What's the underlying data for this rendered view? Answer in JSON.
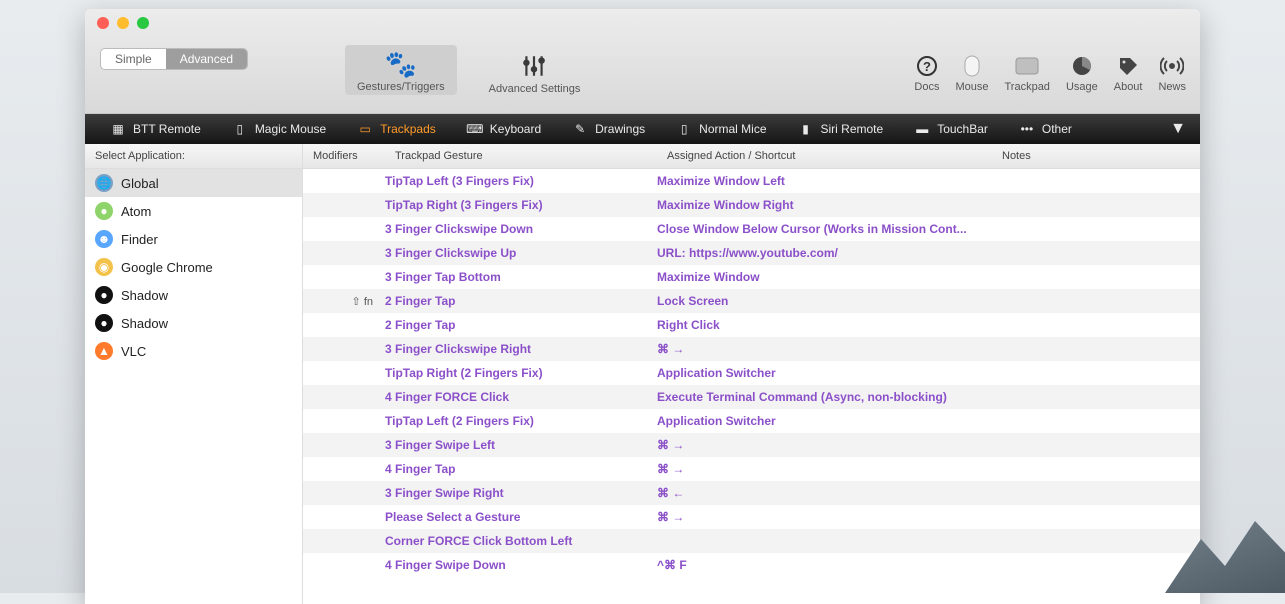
{
  "modes": {
    "simple": "Simple",
    "advanced": "Advanced"
  },
  "toolbar_main": [
    {
      "label": "Gestures/Triggers",
      "icon": "🐾"
    },
    {
      "label": "Advanced Settings",
      "icon": "⚙"
    }
  ],
  "toolbar_right": [
    {
      "label": "Docs",
      "icon": "?"
    },
    {
      "label": "Mouse",
      "icon": "▢"
    },
    {
      "label": "Trackpad",
      "icon": "▭"
    },
    {
      "label": "Usage",
      "icon": "◔"
    },
    {
      "label": "About",
      "icon": "🏷"
    },
    {
      "label": "News",
      "icon": "📶"
    }
  ],
  "devices": [
    {
      "label": "BTT Remote"
    },
    {
      "label": "Magic Mouse"
    },
    {
      "label": "Trackpads",
      "active": true
    },
    {
      "label": "Keyboard"
    },
    {
      "label": "Drawings"
    },
    {
      "label": "Normal Mice"
    },
    {
      "label": "Siri Remote"
    },
    {
      "label": "TouchBar"
    },
    {
      "label": "Other",
      "icon": "•••"
    }
  ],
  "sidebar_header": "Select Application:",
  "apps": [
    {
      "name": "Global",
      "sel": true,
      "color": "#7aa0c4",
      "glyph": "🌐"
    },
    {
      "name": "Atom",
      "color": "#8fd46a",
      "glyph": "●"
    },
    {
      "name": "Finder",
      "color": "#59a6ff",
      "glyph": "☻"
    },
    {
      "name": "Google Chrome",
      "color": "#f3c24a",
      "glyph": "◉"
    },
    {
      "name": "Shadow",
      "color": "#111",
      "glyph": "●"
    },
    {
      "name": "Shadow",
      "color": "#111",
      "glyph": "●"
    },
    {
      "name": "VLC",
      "color": "#ff7a2a",
      "glyph": "▲"
    }
  ],
  "columns": {
    "mod": "Modifiers",
    "gesture": "Trackpad Gesture",
    "action": "Assigned Action / Shortcut",
    "notes": "Notes"
  },
  "rows": [
    {
      "mod": "",
      "gesture": "TipTap Left (3 Fingers Fix)",
      "action": "Maximize Window Left"
    },
    {
      "mod": "",
      "gesture": "TipTap Right (3 Fingers Fix)",
      "action": "Maximize Window Right"
    },
    {
      "mod": "",
      "gesture": "3 Finger Clickswipe Down",
      "action": "Close Window Below Cursor (Works in Mission Cont..."
    },
    {
      "mod": "",
      "gesture": "3 Finger Clickswipe Up",
      "action": "URL: https://www.youtube.com/"
    },
    {
      "mod": "",
      "gesture": "3 Finger Tap Bottom",
      "action": "Maximize Window"
    },
    {
      "mod": "⇧ fn",
      "gesture": "2 Finger Tap",
      "action": "Lock Screen"
    },
    {
      "mod": "",
      "gesture": "2 Finger Tap",
      "action": "Right Click"
    },
    {
      "mod": "",
      "gesture": "3 Finger Clickswipe Right",
      "action": "⌘ →"
    },
    {
      "mod": "",
      "gesture": "TipTap Right (2 Fingers Fix)",
      "action": "Application Switcher"
    },
    {
      "mod": "",
      "gesture": "4 Finger FORCE Click",
      "action": "Execute Terminal Command (Async, non-blocking)"
    },
    {
      "mod": "",
      "gesture": "TipTap Left (2 Fingers Fix)",
      "action": "Application Switcher"
    },
    {
      "mod": "",
      "gesture": "3 Finger Swipe Left",
      "action": "⌘ →"
    },
    {
      "mod": "",
      "gesture": "4 Finger Tap",
      "action": "⌘ →"
    },
    {
      "mod": "",
      "gesture": "3 Finger Swipe Right",
      "action": "⌘ ←"
    },
    {
      "mod": "",
      "gesture": "Please Select a Gesture",
      "action": "⌘ →"
    },
    {
      "mod": "",
      "gesture": "Corner FORCE Click Bottom Left",
      "action": ""
    },
    {
      "mod": "",
      "gesture": "4 Finger Swipe Down",
      "action": "^⌘ F"
    }
  ]
}
